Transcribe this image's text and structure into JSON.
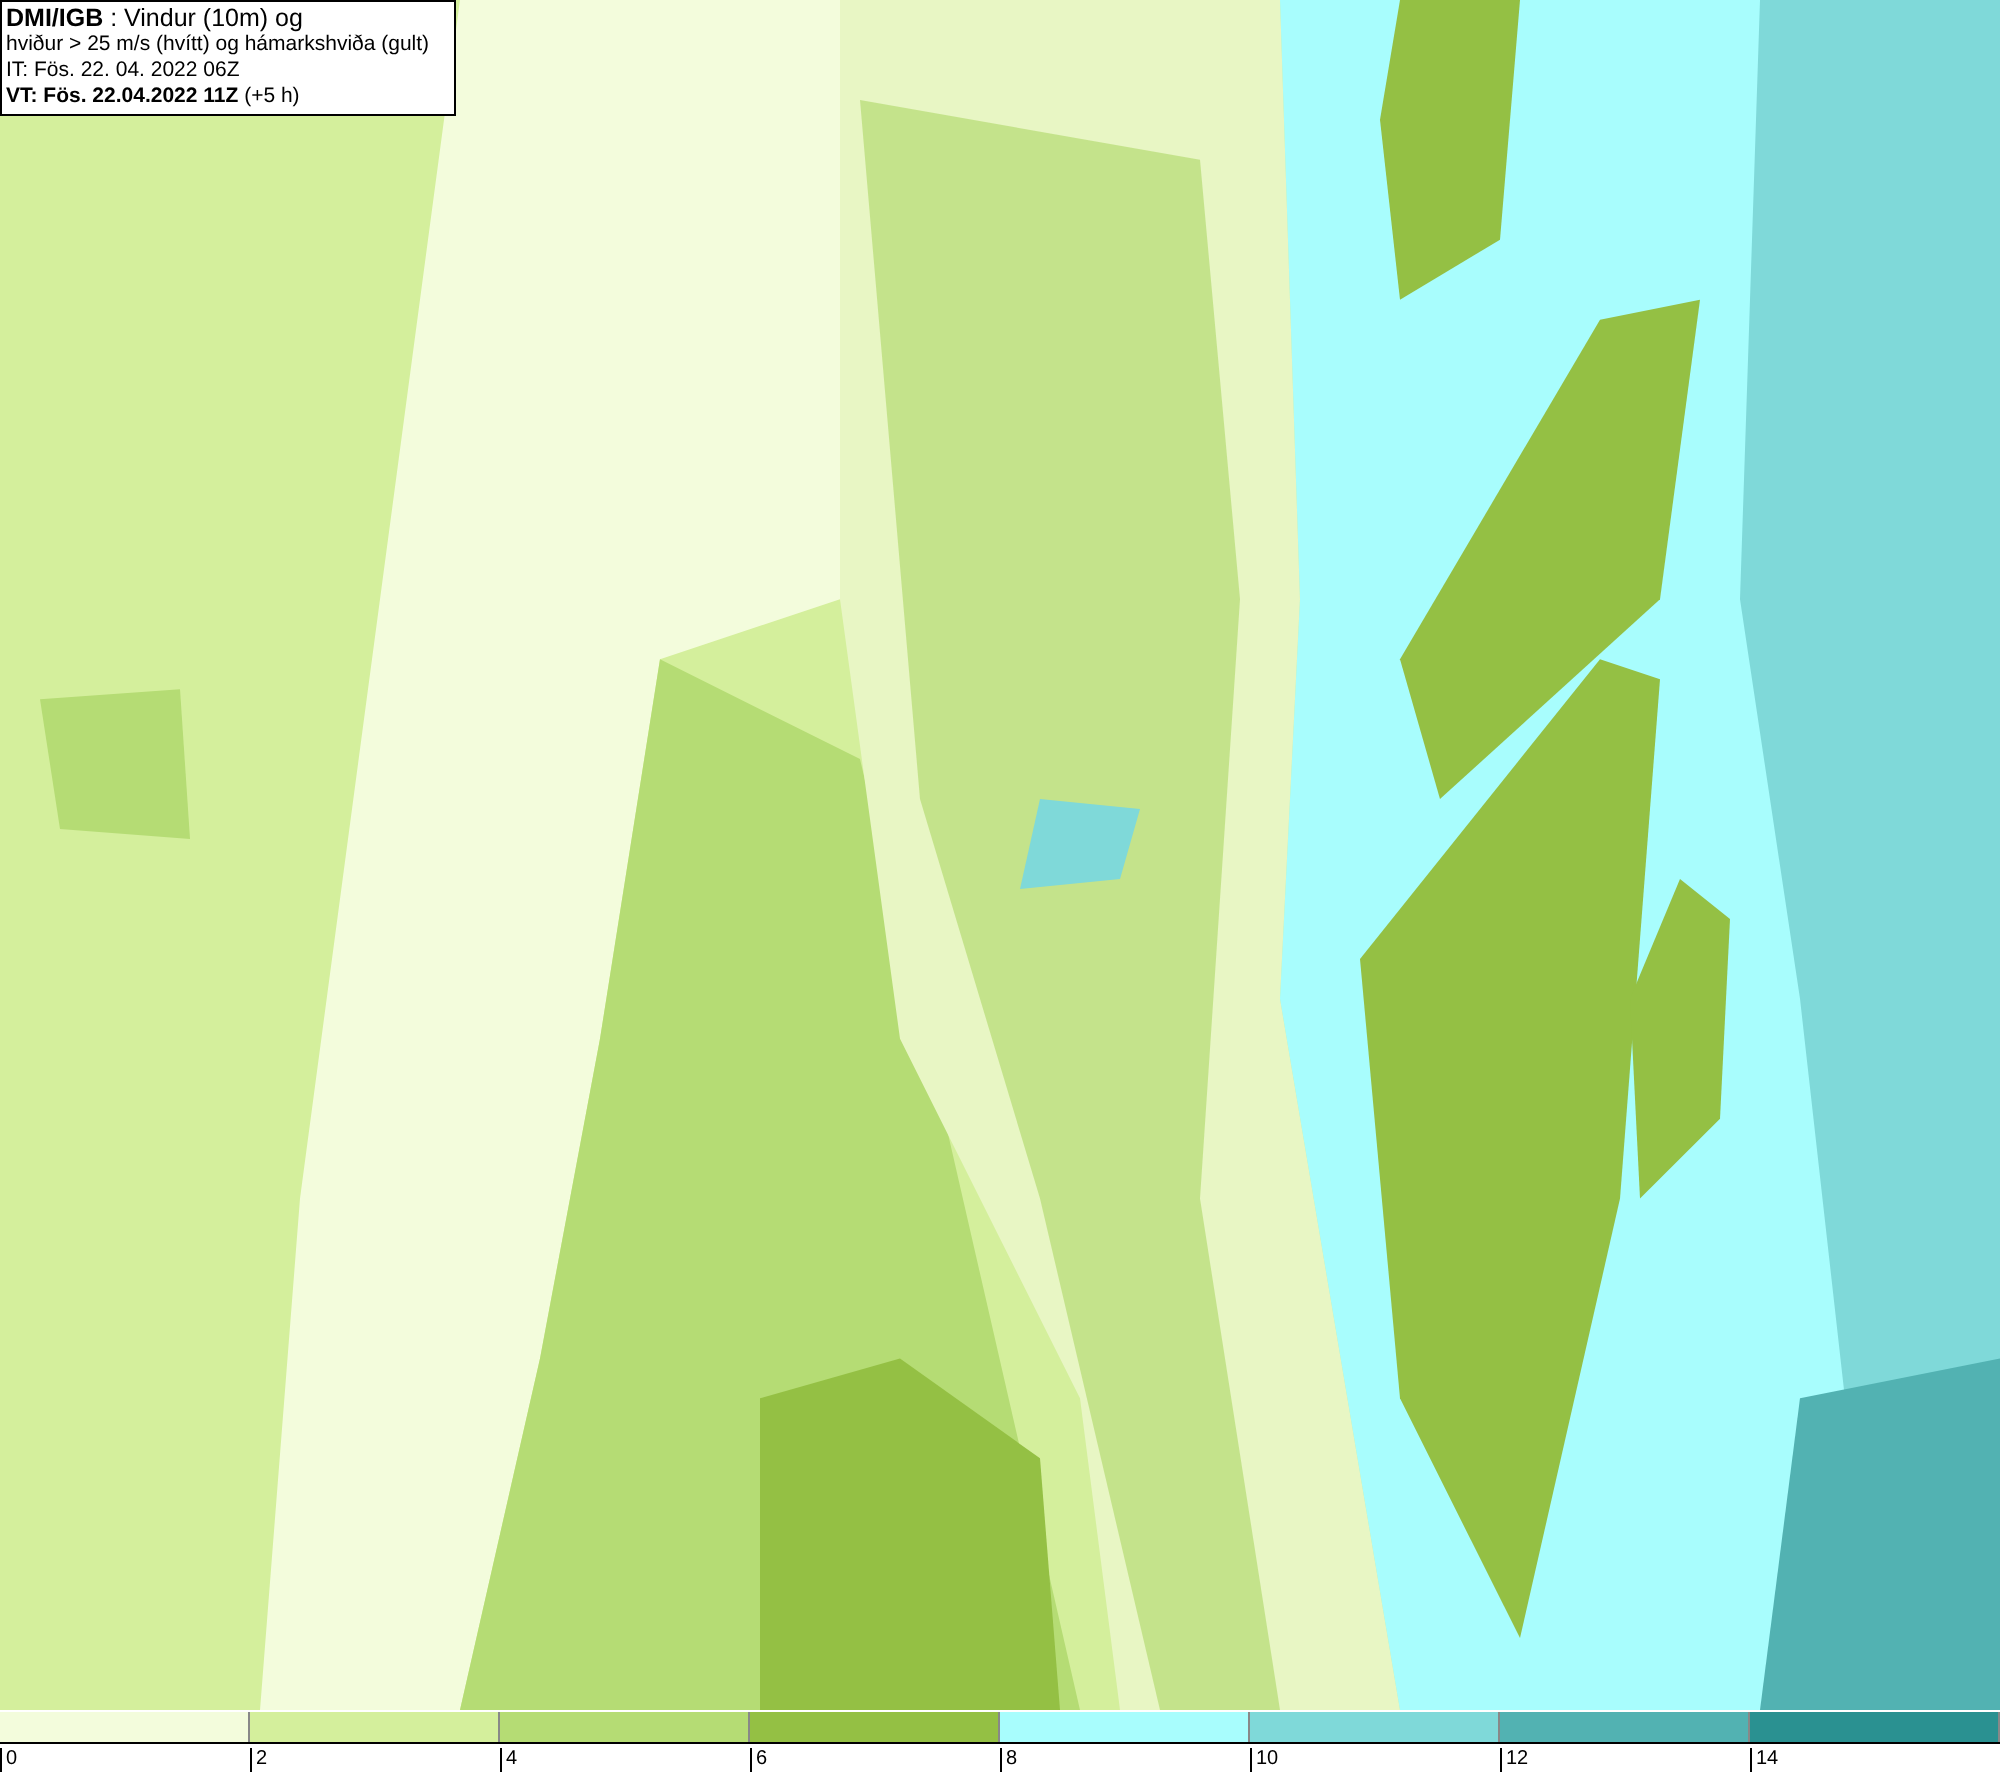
{
  "title_box": {
    "lines": [
      "**DMI/IGB** : Vindur (10m) og",
      "hviður > 25 m/s (hvítt) og hámarkshviða (gult)",
      "IT: Fös. 22. 04. 2022 06Z",
      "**VT: Fös. 22.04.2022 11Z** (+5 h)"
    ]
  },
  "legend": {
    "segments": [
      {
        "color": "#f3fcdc"
      },
      {
        "color": "#d4ef9c"
      },
      {
        "color": "#b5dc74"
      },
      {
        "color": "#94c044"
      },
      {
        "color": "#a8fdfd"
      },
      {
        "color": "#7fd9d9"
      },
      {
        "color": "#52b2b2"
      },
      {
        "color": "#2a9191"
      }
    ],
    "labels": [
      "0",
      "2",
      "4",
      "6",
      "8",
      "10",
      "12",
      "14"
    ]
  }
}
